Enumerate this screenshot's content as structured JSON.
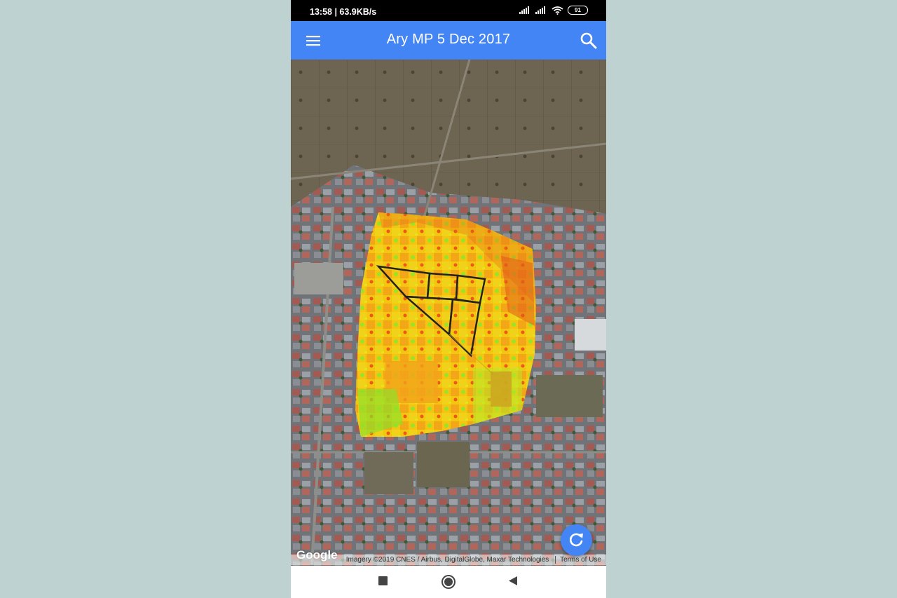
{
  "status_bar": {
    "time_speed": "13:58 | 63.9KB/s",
    "battery": "91"
  },
  "app_bar": {
    "title": "Ary MP 5 Dec 2017",
    "menu_icon": "hamburger-menu-icon",
    "search_icon": "search-icon"
  },
  "map": {
    "type": "satellite",
    "overlay": "ndvi-health-map",
    "google_logo": "Google",
    "attribution": "Imagery ©2019 CNES / Airbus, DigitalGlobe, Maxar Technologies",
    "terms": "Terms of Use"
  },
  "fab": {
    "icon": "refresh-icon"
  },
  "nav_bar": {
    "recents_icon": "square-recents-icon",
    "home_icon": "circle-home-icon",
    "back_icon": "triangle-back-icon"
  },
  "colors": {
    "app_bar": "#4385f4",
    "background": "#bfd2d2"
  }
}
